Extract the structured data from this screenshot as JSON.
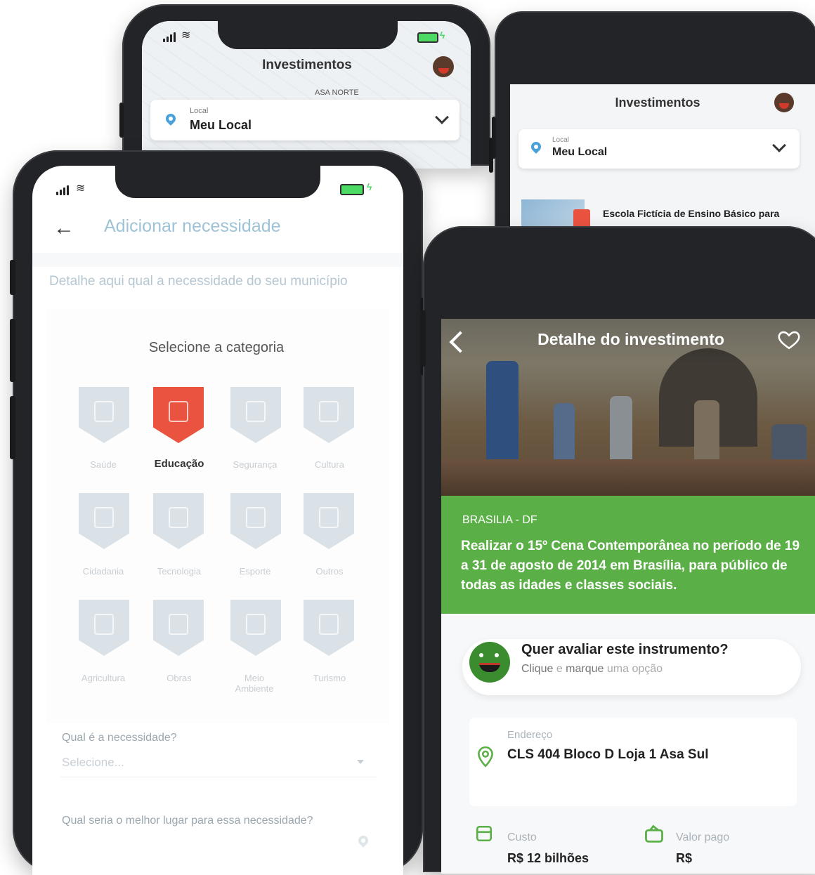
{
  "phone_top": {
    "title": "Investimentos",
    "subtitle": "ASA NORTE",
    "location_caption": "Local",
    "location_value": "Meu Local"
  },
  "phone_back": {
    "title": "Investimentos",
    "location_caption": "Local",
    "location_value": "Meu Local",
    "list_item_title": "Escola Fictícia de Ensino Básico para"
  },
  "phone_add": {
    "title": "Adicionar necessidade",
    "description": "Detalhe aqui qual a necessidade do seu município",
    "section_title": "Selecione a categoria",
    "categories": [
      {
        "label": "Saúde",
        "active": false
      },
      {
        "label": "Educação",
        "active": true
      },
      {
        "label": "Segurança",
        "active": false
      },
      {
        "label": "Cultura",
        "active": false
      },
      {
        "label": "Cidadania",
        "active": false
      },
      {
        "label": "Tecnologia",
        "active": false
      },
      {
        "label": "Esporte",
        "active": false
      },
      {
        "label": "Outros",
        "active": false
      },
      {
        "label": "Agricultura",
        "active": false
      },
      {
        "label": "Obras",
        "active": false
      },
      {
        "label": "Meio Ambiente",
        "active": false
      },
      {
        "label": "Turismo",
        "active": false
      }
    ],
    "need_label": "Qual é a necessidade?",
    "need_placeholder": "Selecione...",
    "place_label": "Qual seria o melhor lugar para essa necessidade?"
  },
  "phone_detail": {
    "title": "Detalhe do investimento",
    "location": "BRASILIA - DF",
    "description": "Realizar o 15º Cena Contemporânea no período de 19 a 31 de agosto de 2014 em Brasília, para público de todas as idades e classes sociais.",
    "rating_title": "Quer avaliar este instrumento?",
    "rating_sub_1": "Clique",
    "rating_sub_2": "e",
    "rating_sub_3": "marque",
    "rating_sub_4": "uma opção",
    "address_label": "Endereço",
    "address_value": "CLS 404 Bloco D Loja 1 Asa Sul",
    "cost_label": "Custo",
    "cost_value": "R$ 12 bilhões",
    "paid_label": "Valor pago",
    "paid_value": "R$"
  },
  "colors": {
    "accent_green": "#5aaf46",
    "accent_red": "#ea5340",
    "accent_blue": "#4aa0d8"
  }
}
